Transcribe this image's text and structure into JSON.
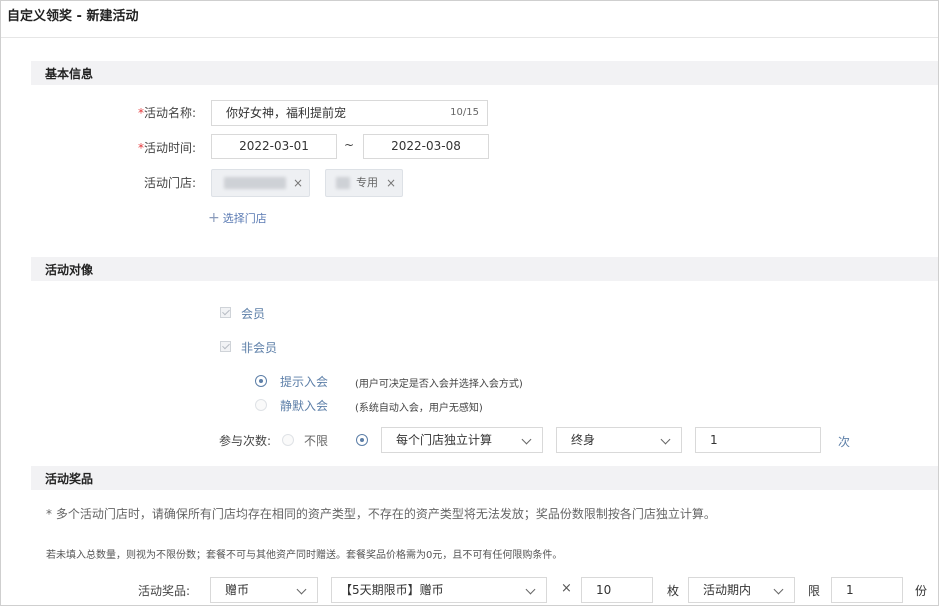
{
  "page": {
    "title": "自定义领奖 - 新建活动"
  },
  "basic": {
    "section_title": "基本信息",
    "name_label": "活动名称:",
    "name_value": "你好女神，福利提前宠",
    "name_count": "10/15",
    "time_label": "活动时间:",
    "start_date": "2022-03-01",
    "date_sep": "~",
    "end_date": "2022-03-08",
    "store_label": "活动门店:",
    "stores": [
      {
        "visible_text": ""
      },
      {
        "visible_text": "专用"
      }
    ],
    "remove_glyph": "×",
    "add_store_plus": "+",
    "add_store": "选择门店"
  },
  "audience": {
    "section_title": "活动对像",
    "member": "会员",
    "non_member": "非会员",
    "join_prompt": "提示入会",
    "join_prompt_hint": "(用户可决定是否入会并选择入会方式)",
    "join_silent": "静默入会",
    "join_silent_hint": "(系统自动入会，用户无感知)",
    "count_label": "参与次数:",
    "unlimited": "不限",
    "calc_mode": "每个门店独立计算",
    "period": "终身",
    "times_value": "1",
    "times_unit": "次"
  },
  "prize": {
    "section_title": "活动奖品",
    "note1": "* 多个活动门店时，请确保所有门店均存在相同的资产类型，不存在的资产类型将无法发放；奖品份数限制按各门店独立计算。",
    "note2": "若未填入总数量，则视为不限份数；套餐不可与其他资产同时赠送。套餐奖品价格需为0元，且不可有任何限购条件。",
    "row_label": "活动奖品:",
    "type": "赠币",
    "item": "【5天期限币】赠币",
    "times_sign": "×",
    "qty": "10",
    "qty_unit": "枚",
    "scope": "活动期内",
    "limit_label": "限",
    "limit_value": "1",
    "limit_unit": "份"
  },
  "colors": {
    "accent": "#5d7fa8",
    "required": "#e4393c",
    "section_bg": "#f2f2f4"
  }
}
